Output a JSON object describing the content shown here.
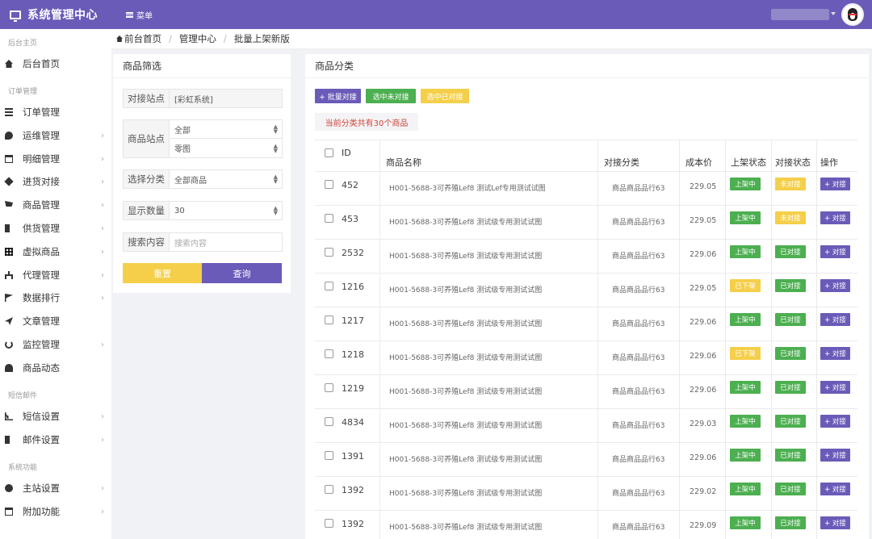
{
  "app": {
    "title": "系统管理中心",
    "menu_label": "菜单"
  },
  "sidebar": {
    "groups": [
      {
        "label": "后台主页"
      },
      {
        "label": "订单管理"
      },
      {
        "label": "短信邮件"
      },
      {
        "label": "系统功能"
      }
    ],
    "items": [
      {
        "label": "后台首页"
      },
      {
        "label": "订单管理"
      },
      {
        "label": "运维管理"
      },
      {
        "label": "明细管理"
      },
      {
        "label": "进货对接"
      },
      {
        "label": "商品管理"
      },
      {
        "label": "供货管理"
      },
      {
        "label": "虚拟商品"
      },
      {
        "label": "代理管理"
      },
      {
        "label": "数据排行"
      },
      {
        "label": "文章管理"
      },
      {
        "label": "监控管理"
      },
      {
        "label": "商品动态"
      },
      {
        "label": "短信设置"
      },
      {
        "label": "邮件设置"
      },
      {
        "label": "主站设置"
      },
      {
        "label": "附加功能"
      }
    ]
  },
  "breadcrumb": {
    "home": "前台首页",
    "level2": "管理中心",
    "current": "批量上架新版"
  },
  "filter": {
    "title": "商品筛选",
    "site_label": "对接站点",
    "site_value": "[彩虹系统]",
    "goods_site_label": "商品站点",
    "goods_site_value1": "全部",
    "goods_site_value2": "零图",
    "category_label": "选择分类",
    "category_value": "全部商品",
    "count_label": "显示数量",
    "count_value": "30",
    "search_label": "搜索内容",
    "search_placeholder": "搜索内容",
    "reset_label": "重置",
    "query_label": "查询"
  },
  "category_panel": {
    "title": "商品分类",
    "batch_button": "+ 批量对接",
    "selected_unlinked_button": "选中未对接",
    "selected_linked_button": "选中已对接",
    "count_note": "当前分类共有30个商品"
  },
  "table": {
    "headers": {
      "id": "ID",
      "name": "商品名称",
      "category": "对接分类",
      "cost": "成本价",
      "shelf": "上架状态",
      "link": "对接状态",
      "action": "操作"
    },
    "rows": [
      {
        "id": "452",
        "name": "H001-5688-3可养殖Lef8 测试Lef专用测试试图",
        "category": "商品商品品行63",
        "cost": "229.05",
        "shelf": "上架中",
        "link": "未对接",
        "action": "+ 对接"
      },
      {
        "id": "453",
        "name": "H001-5688-3可养殖Lef8 测试级专用测试试图",
        "category": "商品商品品行63",
        "cost": "229.05",
        "shelf": "上架中",
        "link": "未对接",
        "action": "+ 对接"
      },
      {
        "id": "2532",
        "name": "H001-5688-3可养殖Lef8 测试级专用测试试图",
        "category": "商品商品品行63",
        "cost": "229.06",
        "shelf": "上架中",
        "link": "已对接",
        "action": "+ 对接"
      },
      {
        "id": "1216",
        "name": "H001-5688-3可养殖Lef8 测试级专用测试试图",
        "category": "商品商品品行63",
        "cost": "229.05",
        "shelf": "已下架",
        "link": "已对接",
        "action": "+ 对接"
      },
      {
        "id": "1217",
        "name": "H001-5688-3可养殖Lef8 测试级专用测试试图",
        "category": "商品商品品行63",
        "cost": "229.06",
        "shelf": "上架中",
        "link": "已对接",
        "action": "+ 对接"
      },
      {
        "id": "1218",
        "name": "H001-5688-3可养殖Lef8 测试级专用测试试图",
        "category": "商品商品品行63",
        "cost": "229.06",
        "shelf": "已下架",
        "link": "已对接",
        "action": "+ 对接"
      },
      {
        "id": "1219",
        "name": "H001-5688-3可养殖Lef8 测试级专用测试试图",
        "category": "商品商品品行63",
        "cost": "229.06",
        "shelf": "上架中",
        "link": "已对接",
        "action": "+ 对接"
      },
      {
        "id": "4834",
        "name": "H001-5688-3可养殖Lef8 测试级专用测试试图",
        "category": "商品商品品行63",
        "cost": "229.03",
        "shelf": "上架中",
        "link": "已对接",
        "action": "+ 对接"
      },
      {
        "id": "1391",
        "name": "H001-5688-3可养殖Lef8 测试级专用测试试图",
        "category": "商品商品品行63",
        "cost": "229.06",
        "shelf": "上架中",
        "link": "已对接",
        "action": "+ 对接"
      },
      {
        "id": "1392",
        "name": "H001-5688-3可养殖Lef8 测试级专用测试试图",
        "category": "商品商品品行63",
        "cost": "229.02",
        "shelf": "上架中",
        "link": "已对接",
        "action": "+ 对接"
      },
      {
        "id": "1392",
        "name": "H001-5688-3可养殖Lef8 测试级专用测试试图",
        "category": "商品商品品行63",
        "cost": "229.09",
        "shelf": "上架中",
        "link": "已对接",
        "action": "+ 对接"
      }
    ]
  },
  "colors": {
    "primary": "#6a5bb8",
    "green": "#4caf50",
    "yellow": "#f5cf4a",
    "red_note": "#d0453a"
  }
}
